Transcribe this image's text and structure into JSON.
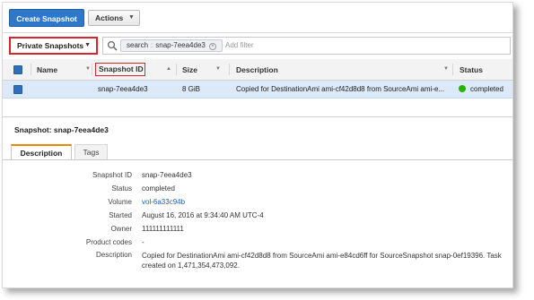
{
  "toolbar": {
    "create_label": "Create Snapshot",
    "actions_label": "Actions"
  },
  "filter": {
    "owner_dropdown": "Private Snapshots",
    "token_key": "search",
    "token_value": "snap-7eea4de3",
    "placeholder": "Add filter"
  },
  "table": {
    "columns": {
      "name": "Name",
      "snapshot_id": "Snapshot ID",
      "size": "Size",
      "description": "Description",
      "status": "Status"
    },
    "rows": [
      {
        "snapshot_id": "snap-7eea4de3",
        "size": "8 GiB",
        "description": "Copied for DestinationAmi ami-cf42d8d8 from SourceAmi ami-e...",
        "status": "completed"
      }
    ]
  },
  "details": {
    "title": "Snapshot: snap-7eea4de3",
    "tabs": [
      "Description",
      "Tags"
    ],
    "fields": [
      {
        "label": "Snapshot ID",
        "value": "snap-7eea4de3"
      },
      {
        "label": "Status",
        "value": "completed"
      },
      {
        "label": "Volume",
        "value": "vol-6a33c94b"
      },
      {
        "label": "Started",
        "value": "August 16, 2016 at 9:34:40 AM UTC-4"
      },
      {
        "label": "Owner",
        "value": "111111111111"
      },
      {
        "label": "Product codes",
        "value": "-"
      },
      {
        "label": "Description",
        "value": "Copied for DestinationAmi ami-cf42d8d8 from SourceAmi ami-e84cd6ff for SourceSnapshot snap-0ef19396. Task created on 1,471,354,473,092."
      }
    ],
    "description_lines": [
      "Copied for DestinationAmi ami-cf42d8d8 from SourceAmi ami-e84cd6ff for SourceSnapshot snap-0ef19396. Task",
      "created on 1,471,354,473,092."
    ]
  },
  "colors": {
    "primary_button": "#2f77c8",
    "selected_row": "#dbe9f8",
    "highlight_border": "#d9262a",
    "status_completed": "#27b300",
    "active_tab_accent": "#e68a00",
    "link": "#1b62b8"
  },
  "icons": [
    "search-icon",
    "chevron-down-icon",
    "sort-up-icon",
    "status-dot-icon",
    "remove-token-icon"
  ]
}
